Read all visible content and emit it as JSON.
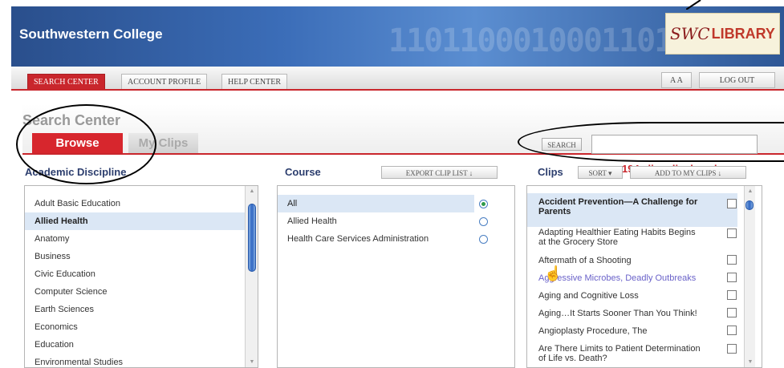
{
  "header": {
    "college_title": "Southwestern College",
    "binary_decoration": "1101100010001101",
    "logo_swc": "SWC",
    "logo_library": "LIBRARY"
  },
  "nav": {
    "tabs": [
      {
        "label": "Search Center",
        "active": true
      },
      {
        "label": "Account Profile",
        "active": false
      },
      {
        "label": "Help Center",
        "active": false
      }
    ],
    "font_toggle": "A A",
    "logout": "Log Out"
  },
  "search": {
    "title": "Search Center",
    "button": "Search",
    "placeholder": "",
    "value": "",
    "clips_count": "194 clips displayed"
  },
  "tabs": {
    "browse": "Browse",
    "my_clips": "My Clips"
  },
  "columns": {
    "discipline_header": "Academic Discipline",
    "course_header": "Course",
    "clips_header": "Clips",
    "export_btn": "Export Clip List ↓",
    "sort_btn": "Sort ▾",
    "add_btn": "Add to My Clips ↓"
  },
  "disciplines": [
    {
      "label": "Adult Basic Education",
      "selected": false
    },
    {
      "label": "Allied Health",
      "selected": true
    },
    {
      "label": "Anatomy",
      "selected": false
    },
    {
      "label": "Business",
      "selected": false
    },
    {
      "label": "Civic Education",
      "selected": false
    },
    {
      "label": "Computer Science",
      "selected": false
    },
    {
      "label": "Earth Sciences",
      "selected": false
    },
    {
      "label": "Economics",
      "selected": false
    },
    {
      "label": "Education",
      "selected": false
    },
    {
      "label": "Environmental Studies",
      "selected": false
    }
  ],
  "courses": [
    {
      "label": "All",
      "checked": true
    },
    {
      "label": "Allied Health",
      "checked": false
    },
    {
      "label": "Health Care Services Administration",
      "checked": false
    }
  ],
  "clips": [
    {
      "line1": "Accident Prevention—A Challenge for",
      "line2": "Parents",
      "style": "bold"
    },
    {
      "line1": "Adapting Healthier Eating Habits Begins",
      "line2": "at the Grocery Store",
      "style": "normal"
    },
    {
      "line1": "Aftermath of a Shooting",
      "line2": "",
      "style": "normal"
    },
    {
      "line1": "Aggressive Microbes, Deadly Outbreaks",
      "line2": "",
      "style": "link"
    },
    {
      "line1": "Aging and Cognitive Loss",
      "line2": "",
      "style": "normal"
    },
    {
      "line1": "Aging…It Starts Sooner Than You Think!",
      "line2": "",
      "style": "normal"
    },
    {
      "line1": "Angioplasty Procedure, The",
      "line2": "",
      "style": "normal"
    },
    {
      "line1": "Are There Limits to Patient Determination",
      "line2": "of Life vs. Death?",
      "style": "normal"
    }
  ],
  "colors": {
    "accent_red": "#c9262c",
    "selection_blue": "#dbe7f5",
    "header_blue": "#2c3e6e"
  }
}
